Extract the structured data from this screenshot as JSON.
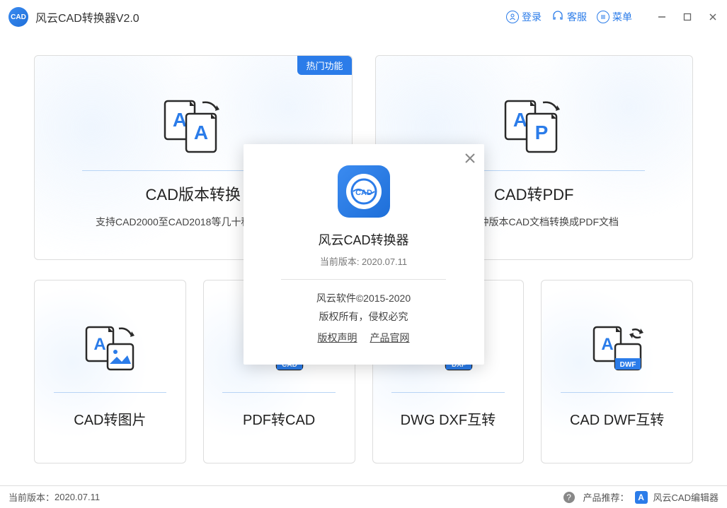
{
  "app": {
    "title": "风云CAD转换器V2.0",
    "icon_label": "CAD"
  },
  "header": {
    "login": "登录",
    "support": "客服",
    "menu": "菜单"
  },
  "cards": {
    "top": [
      {
        "badge": "热门功能",
        "title": "CAD版本转换",
        "desc": "支持CAD2000至CAD2018等几十种版本转换"
      },
      {
        "badge": null,
        "title": "CAD转PDF",
        "desc": "支持多种版本CAD文档转换成PDF文档"
      }
    ],
    "bottom": [
      {
        "title": "CAD转图片"
      },
      {
        "title": "PDF转CAD"
      },
      {
        "title": "DWG DXF互转"
      },
      {
        "title": "CAD DWF互转"
      }
    ]
  },
  "modal": {
    "title": "风云CAD转换器",
    "version_label": "当前版本: 2020.07.11",
    "company": "风云软件©2015-2020",
    "rights": "版权所有，侵权必究",
    "link_terms": "版权声明",
    "link_site": "产品官网"
  },
  "statusbar": {
    "version_label": "当前版本：",
    "version_value": "2020.07.11",
    "recommend_label": "产品推荐：",
    "product": "风云CAD编辑器"
  }
}
